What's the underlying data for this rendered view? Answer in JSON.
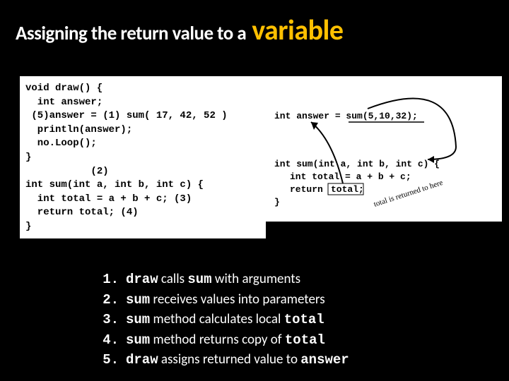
{
  "title": {
    "small": "Assigning the return value to a",
    "big": "variable"
  },
  "code": "void draw() {\n  int answer;\n (5)answer = (1) sum( 17, 42, 52 )\n  println(answer);\n  no.Loop();\n}\n           (2)\nint sum(int a, int b, int c) {\n  int total = a + b + c; (3)\n  return total; (4)\n}",
  "diagram": {
    "call_line": "int answer = sum(5,10,32);",
    "decl_line": "int sum(int a, int b, int c) {",
    "body_line": "int total = a + b + c;",
    "ret_line": "return total;",
    "close": "}",
    "note_top": "",
    "note_side": "total is returned to here"
  },
  "steps": [
    {
      "n": "1.",
      "parts": [
        "draw",
        " calls ",
        "sum",
        " with arguments"
      ]
    },
    {
      "n": "2.",
      "parts": [
        "sum",
        " receives values into parameters"
      ]
    },
    {
      "n": "3.",
      "parts": [
        "sum",
        " method calculates local ",
        "total"
      ]
    },
    {
      "n": "4.",
      "parts": [
        "sum",
        " method returns copy of ",
        "total"
      ]
    },
    {
      "n": "5.",
      "parts": [
        "draw",
        " assigns returned  value to ",
        "answer"
      ]
    }
  ]
}
